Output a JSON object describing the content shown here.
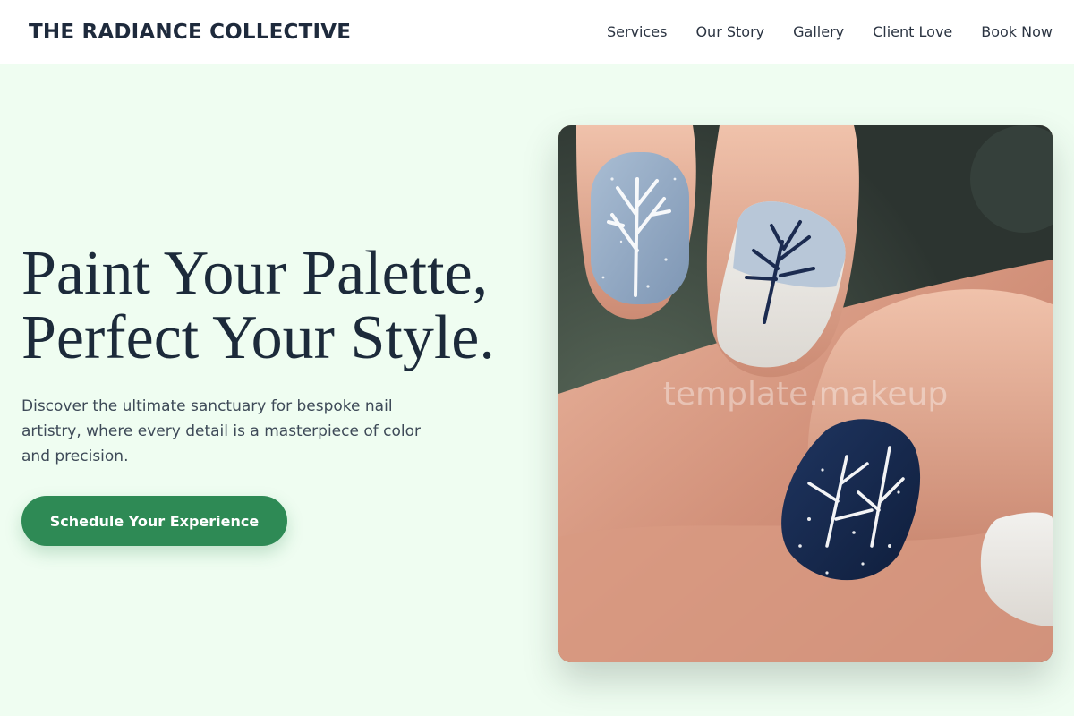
{
  "header": {
    "brand": "THE RADIANCE COLLECTIVE",
    "nav": [
      "Services",
      "Our Story",
      "Gallery",
      "Client Love",
      "Book Now"
    ]
  },
  "hero": {
    "headline_line1": "Paint Your Palette,",
    "headline_line2": "Perfect Your Style.",
    "description": "Discover the ultimate sanctuary for bespoke nail artistry, where every detail is a masterpiece of color and precision.",
    "cta_label": "Schedule Your Experience"
  },
  "image": {
    "subject": "winter-tree-nail-art",
    "watermark": "template.makeup"
  },
  "colors": {
    "background": "#effdf1",
    "header": "#ffffff",
    "heading": "#1c2a3a",
    "accent": "#2e8a55",
    "skin": "#d69a82",
    "nail_blue": "#8ea6c2",
    "nail_navy": "#172a4e",
    "nail_white": "#eceae6"
  }
}
